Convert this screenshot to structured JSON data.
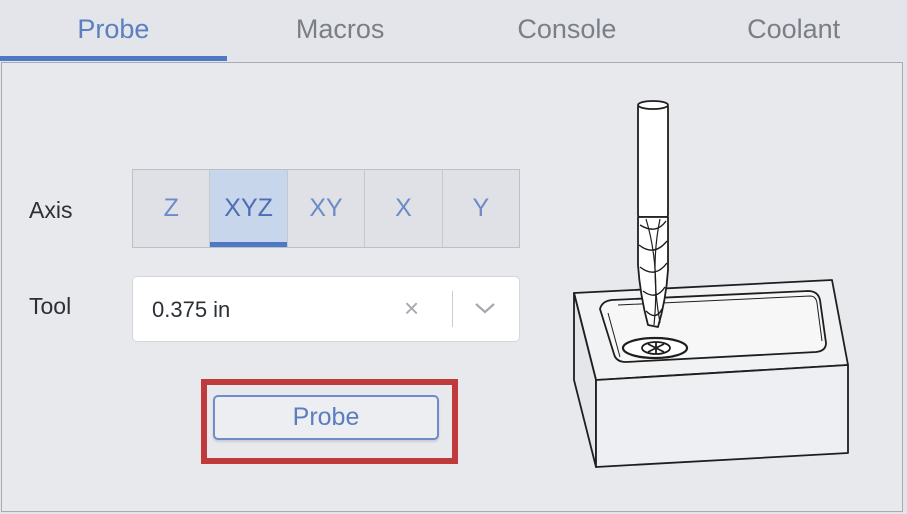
{
  "tabs": [
    {
      "label": "Probe",
      "active": true
    },
    {
      "label": "Macros",
      "active": false
    },
    {
      "label": "Console",
      "active": false
    },
    {
      "label": "Coolant",
      "active": false
    }
  ],
  "axis": {
    "label": "Axis",
    "options": [
      "Z",
      "XYZ",
      "XY",
      "X",
      "Y"
    ],
    "selected": "XYZ"
  },
  "tool": {
    "label": "Tool",
    "value": "0.375 in",
    "clear_icon": "clear-icon",
    "dropdown_icon": "chevron-down-icon"
  },
  "probe_button": {
    "label": "Probe"
  },
  "illustration": {
    "icon": "endmill-touch-plate-illustration"
  },
  "colors": {
    "accent": "#4f78c4",
    "highlight_border": "#c0393b",
    "background": "#e3e5ea"
  }
}
